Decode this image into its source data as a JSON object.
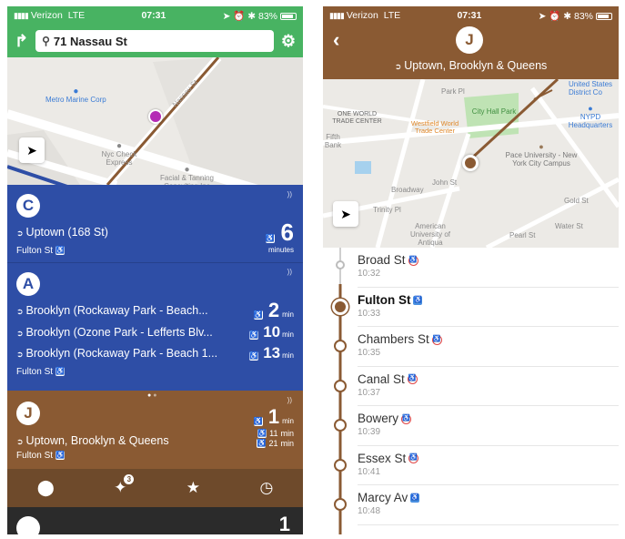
{
  "left": {
    "status": {
      "carrier": "Verizon",
      "network": "LTE",
      "time": "07:31",
      "battery": "83%"
    },
    "search": {
      "value": "71 Nassau St"
    },
    "map": {
      "pois": [
        "Metro Marine Corp",
        "Nyc Check Express",
        "Facial & Tanning Consulting Inc"
      ],
      "street": "Nassau St"
    },
    "cards": [
      {
        "line": "C",
        "color": "#2e4ea6",
        "destinations": [
          {
            "text": "Uptown (168 St)",
            "time": "6",
            "unit": "minutes"
          }
        ],
        "stop": "Fulton St"
      },
      {
        "line": "A",
        "color": "#2e4ea6",
        "destinations": [
          {
            "text": "Brooklyn (Rockaway Park - Beach...",
            "time": "2",
            "unit": "min"
          },
          {
            "text": "Brooklyn (Ozone Park - Lefferts Blv...",
            "time": "10",
            "unit": "min"
          },
          {
            "text": "Brooklyn (Rockaway Park - Beach 1...",
            "time": "13",
            "unit": "min"
          }
        ],
        "stop": "Fulton St"
      },
      {
        "line": "J",
        "color": "#8a5a33",
        "destinations": [
          {
            "text": "Uptown, Brooklyn & Queens",
            "time": "1",
            "unit": "min"
          }
        ],
        "extra_times": [
          {
            "time": "11",
            "unit": "min"
          },
          {
            "time": "21",
            "unit": "min"
          }
        ],
        "stop": "Fulton St"
      }
    ],
    "tabbar": {
      "alerts_badge": "3"
    },
    "next_card_time": "1"
  },
  "right": {
    "status": {
      "carrier": "Verizon",
      "network": "LTE",
      "time": "07:31",
      "battery": "83%"
    },
    "header": {
      "line": "J",
      "direction": "Uptown, Brooklyn & Queens"
    },
    "map": {
      "pois": [
        "ONE WORLD TRADE CENTER",
        "Westfield World Trade Center",
        "City Hall Park",
        "Pace University - New York City Campus",
        "NYPD Headquarters",
        "United States District Co",
        "American University of Antiqua",
        "Fifth Bank",
        "Park Pl",
        "Trinity Pl",
        "Broadway",
        "John St",
        "Pearl St",
        "Water St",
        "Gold St"
      ]
    },
    "stops": [
      {
        "name": "Broad St",
        "time": "10:32",
        "accessible": false,
        "state": "past"
      },
      {
        "name": "Fulton St",
        "time": "10:33",
        "accessible": true,
        "state": "current"
      },
      {
        "name": "Chambers St",
        "time": "10:35",
        "accessible": false,
        "state": "next"
      },
      {
        "name": "Canal St",
        "time": "10:37",
        "accessible": false,
        "state": "next"
      },
      {
        "name": "Bowery",
        "time": "10:39",
        "accessible": false,
        "state": "next"
      },
      {
        "name": "Essex St",
        "time": "10:41",
        "accessible": false,
        "state": "next"
      },
      {
        "name": "Marcy Av",
        "time": "10:48",
        "accessible": true,
        "state": "next"
      }
    ]
  }
}
